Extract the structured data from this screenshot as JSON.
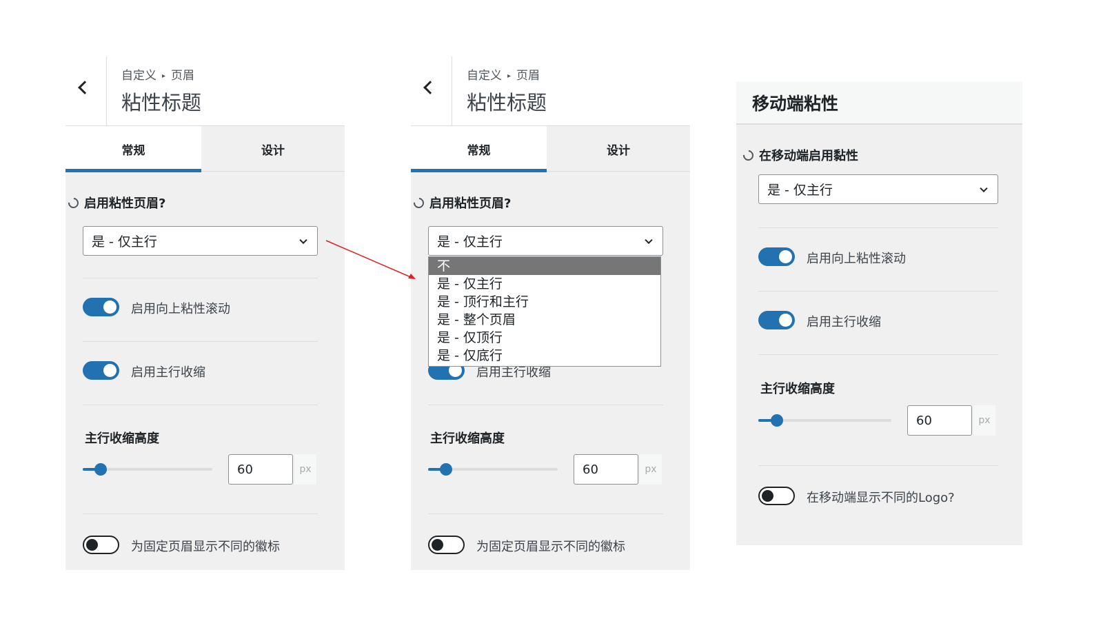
{
  "left_panel": {
    "breadcrumb": {
      "root": "自定义",
      "parent": "页眉"
    },
    "title": "粘性标题",
    "tabs": {
      "general": "常规",
      "design": "设计"
    },
    "sticky_header_label": "启用粘性页眉?",
    "sticky_header_value": "是 - 仅主行",
    "toggle_scroll_up": {
      "label": "启用向上粘性滚动",
      "on": true
    },
    "toggle_shrink": {
      "label": "启用主行收缩",
      "on": true
    },
    "shrink_height": {
      "label": "主行收缩高度",
      "value": "60",
      "unit": "px",
      "fraction": 0.14
    },
    "toggle_logo": {
      "label": "为固定页眉显示不同的徽标",
      "on": false
    }
  },
  "middle_panel": {
    "breadcrumb": {
      "root": "自定义",
      "parent": "页眉"
    },
    "title": "粘性标题",
    "tabs": {
      "general": "常规",
      "design": "设计"
    },
    "sticky_header_label": "启用粘性页眉?",
    "sticky_header_value": "是 - 仅主行",
    "dropdown_options": [
      "不",
      "是 - 仅主行",
      "是 - 顶行和主行",
      "是 - 整个页眉",
      "是 - 仅顶行",
      "是 - 仅底行"
    ],
    "highlighted_option": "不",
    "toggle_shrink_partial_label": "启用主行收缩",
    "shrink_height": {
      "label": "主行收缩高度",
      "value": "60",
      "unit": "px",
      "fraction": 0.14
    },
    "toggle_logo": {
      "label": "为固定页眉显示不同的徽标",
      "on": false
    }
  },
  "right_panel": {
    "title": "移动端粘性",
    "mobile_sticky_label": "在移动端启用黏性",
    "mobile_sticky_value": "是 - 仅主行",
    "toggle_scroll_up": {
      "label": "启用向上粘性滚动",
      "on": true
    },
    "toggle_shrink": {
      "label": "启用主行收缩",
      "on": true
    },
    "shrink_height": {
      "label": "主行收缩高度",
      "value": "60",
      "unit": "px",
      "fraction": 0.14
    },
    "toggle_mobile_logo": {
      "label": "在移动端显示不同的Logo?",
      "on": false
    }
  },
  "colors": {
    "accent": "#2271b1",
    "panel_bg": "#f0f0f1",
    "annotation_arrow": "#e02020",
    "dropdown_highlight": "#767676"
  },
  "icons": [
    "chevron-left-icon",
    "reset-icon",
    "chevron-down-icon",
    "breadcrumb-arrow-icon"
  ]
}
